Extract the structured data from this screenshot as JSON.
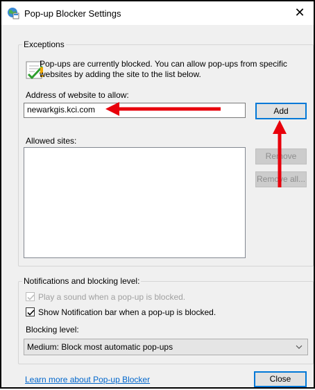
{
  "window": {
    "title": "Pop-up Blocker Settings",
    "close_glyph": "✕"
  },
  "exceptions": {
    "group_label": "Exceptions",
    "info_line1": "Pop-ups are currently blocked.  You can allow pop-ups from specific",
    "info_line2": "websites by adding the site to the list below.",
    "address_label": "Address of website to allow:",
    "address_value": "newarkgis.kci.com",
    "add_button": "Add",
    "allowed_label": "Allowed sites:",
    "remove_button": "Remove",
    "remove_all_button": "Remove all..."
  },
  "notifications": {
    "group_label": "Notifications and blocking level:",
    "play_sound_label": "Play a sound when a pop-up is blocked.",
    "play_sound_checked": true,
    "show_bar_label": "Show Notification bar when a pop-up is blocked.",
    "show_bar_checked": true,
    "blocking_level_label": "Blocking level:",
    "blocking_level_value": "Medium: Block most automatic pop-ups"
  },
  "footer": {
    "learn_more_link": "Learn more about Pop-up Blocker",
    "close_button": "Close"
  },
  "annotations": {
    "arrow_color": "#e8000b"
  }
}
